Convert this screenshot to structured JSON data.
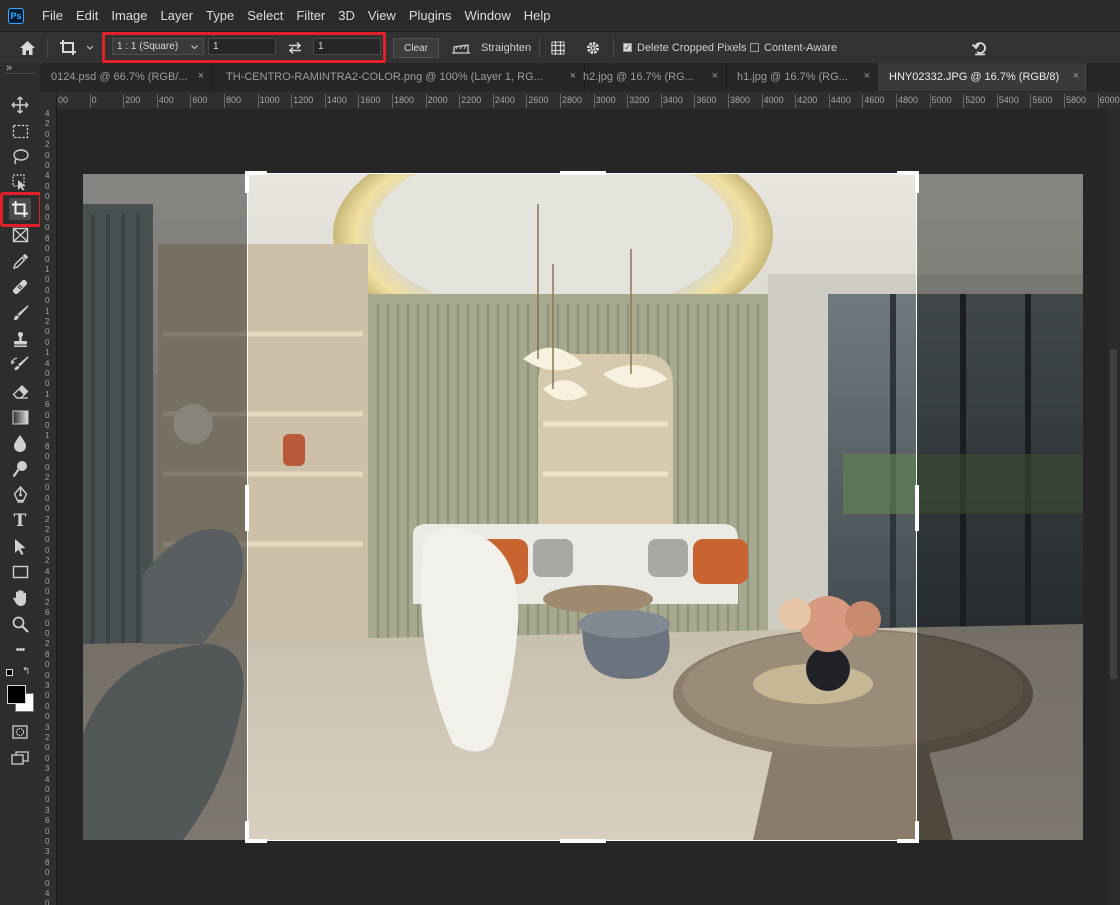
{
  "app": {
    "logo_text": "Ps"
  },
  "menu": [
    "File",
    "Edit",
    "Image",
    "Layer",
    "Type",
    "Select",
    "Filter",
    "3D",
    "View",
    "Plugins",
    "Window",
    "Help"
  ],
  "options_bar": {
    "ratio_preset": "1 : 1 (Square)",
    "width_value": "1",
    "height_value": "1",
    "clear_label": "Clear",
    "straighten_label": "Straighten",
    "delete_cropped_label": "Delete Cropped Pixels",
    "delete_cropped_checked": true,
    "content_aware_label": "Content-Aware",
    "content_aware_checked": false
  },
  "tabs": [
    {
      "label": "0124.psd @ 66.7% (RGB/...",
      "active": false
    },
    {
      "label": "TH-CENTRO-RAMINTRA2-COLOR.png @ 100% (Layer 1, RG...",
      "active": false
    },
    {
      "label": "h2.jpg @ 16.7% (RG...",
      "active": false
    },
    {
      "label": "h1.jpg @ 16.7% (RG...",
      "active": false
    },
    {
      "label": "HNY02332.JPG @ 16.7% (RGB/8)",
      "active": true
    }
  ],
  "tab_close_glyph": "×",
  "ruler_h": [
    "00",
    "0",
    "200",
    "400",
    "600",
    "800",
    "1000",
    "1200",
    "1400",
    "1600",
    "1800",
    "2000",
    "2200",
    "2400",
    "2600",
    "2800",
    "3000",
    "3200",
    "3400",
    "3600",
    "3800",
    "4000",
    "4200",
    "4400",
    "4600",
    "4800",
    "5000",
    "5200",
    "5400",
    "5600",
    "5800",
    "6000"
  ],
  "ruler_v": [
    "4",
    "2",
    "0",
    "2",
    "0",
    "0",
    "4",
    "0",
    "0",
    "6",
    "0",
    "0",
    "8",
    "0",
    "0",
    "1",
    "0",
    "0",
    "0",
    "1",
    "2",
    "0",
    "0",
    "1",
    "4",
    "0",
    "0",
    "1",
    "6",
    "0",
    "0",
    "1",
    "8",
    "0",
    "0",
    "2",
    "0",
    "0",
    "0",
    "2",
    "2",
    "0",
    "0",
    "2",
    "4",
    "0",
    "0",
    "2",
    "6",
    "0",
    "0",
    "2",
    "8",
    "0",
    "0",
    "3",
    "0",
    "0",
    "0",
    "3",
    "2",
    "0",
    "0",
    "3",
    "4",
    "0",
    "0",
    "3",
    "6",
    "0",
    "0",
    "3",
    "8",
    "0",
    "0",
    "4",
    "0",
    "0",
    "0"
  ],
  "tools": [
    "move-tool-icon",
    "marquee-tool-icon",
    "lasso-tool-icon",
    "object-select-tool-icon",
    "crop-tool-icon",
    "frame-tool-icon",
    "eyedropper-tool-icon",
    "healing-brush-tool-icon",
    "brush-tool-icon",
    "clone-stamp-tool-icon",
    "history-brush-tool-icon",
    "eraser-tool-icon",
    "gradient-tool-icon",
    "blur-tool-icon",
    "dodge-tool-icon",
    "pen-tool-icon",
    "type-tool-icon",
    "path-select-tool-icon",
    "rectangle-tool-icon",
    "hand-tool-icon",
    "zoom-tool-icon",
    "more-tools-icon"
  ],
  "type_tool_glyph": "T",
  "more_tools_glyph": "•••",
  "toolbar_expand_glyph": "»",
  "swap_colors_glyph": "↰",
  "colors": {
    "foreground": "#000000",
    "background": "#ffffff",
    "highlight": "#e0202a"
  }
}
